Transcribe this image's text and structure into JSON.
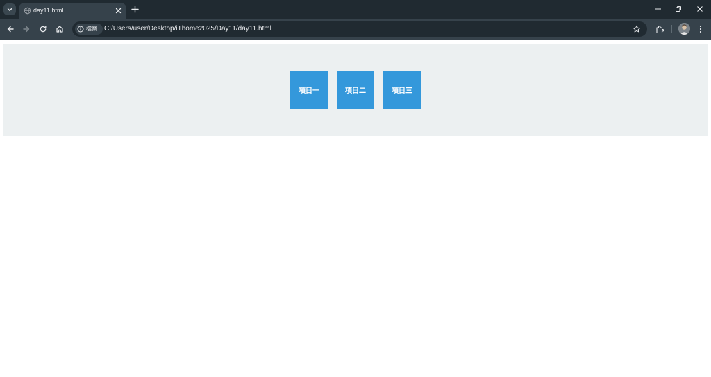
{
  "tab": {
    "title": "day11.html"
  },
  "omnibox": {
    "chip_label": "檔案",
    "url": "C:/Users/user/Desktop/iThome2025/Day11/day11.html"
  },
  "menu": {
    "items": [
      {
        "label": "項目一"
      },
      {
        "label": "項目二"
      },
      {
        "label": "項目三"
      }
    ]
  },
  "colors": {
    "menu_bar_bg": "#ecf0f1",
    "menu_item_bg": "#3498db",
    "menu_item_text": "#ffffff"
  }
}
